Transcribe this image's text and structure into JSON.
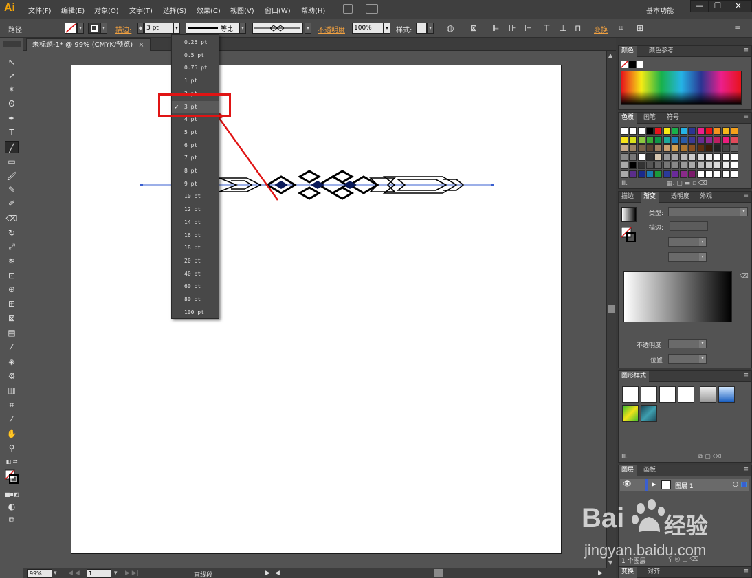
{
  "app": {
    "logo": "Ai",
    "menu": [
      "文件(F)",
      "编辑(E)",
      "对象(O)",
      "文字(T)",
      "选择(S)",
      "效果(C)",
      "视图(V)",
      "窗口(W)",
      "帮助(H)"
    ],
    "workspace": "基本功能",
    "window_buttons": {
      "minimize": "—",
      "restore": "❐",
      "close": "✕"
    }
  },
  "control_bar": {
    "object_type": "路径",
    "stroke_label": "描边:",
    "stroke_value": "3 pt",
    "profile_label": "等比",
    "opacity_label": "不透明度",
    "opacity_value": "100%",
    "style_label": "样式:",
    "transform_label": "变换"
  },
  "document": {
    "tab_title": "未标题-1* @ 99% (CMYK/预览)",
    "tab_close": "×"
  },
  "stroke_dropdown": {
    "items": [
      "0.25 pt",
      "0.5 pt",
      "0.75 pt",
      "1 pt",
      "2 pt",
      "3 pt",
      "4 pt",
      "5 pt",
      "6 pt",
      "7 pt",
      "8 pt",
      "9 pt",
      "10 pt",
      "12 pt",
      "14 pt",
      "16 pt",
      "18 pt",
      "20 pt",
      "40 pt",
      "60 pt",
      "80 pt",
      "100 pt"
    ],
    "selected_index": 5,
    "check_mark": "✔"
  },
  "status_bar": {
    "zoom": "99%",
    "artboard_number": "1",
    "tool_name": "直线段"
  },
  "panels": {
    "color": {
      "tabs": [
        "颜色",
        "颜色参考"
      ]
    },
    "swatches": {
      "tabs": [
        "色板",
        "画笔",
        "符号"
      ]
    },
    "gradient": {
      "tabs": [
        "描边",
        "渐变",
        "透明度",
        "外观"
      ],
      "type_label": "类型:",
      "stroke_label": "描边:",
      "opacity_label": "不透明度",
      "location_label": "位置"
    },
    "graphic_styles": {
      "tabs": [
        "图形样式"
      ]
    },
    "layers": {
      "tabs": [
        "图层",
        "画板"
      ],
      "layer_name": "图层 1",
      "footer_text": "1 个图层"
    },
    "bottom": {
      "tabs": [
        "变换",
        "对齐"
      ]
    }
  },
  "colors": {
    "accent_orange": "#f0a30a",
    "highlight_red": "#e01414",
    "selection_blue": "#3a5fd0"
  },
  "watermark": {
    "brand": "Bai",
    "brand_cn": "经验",
    "url": "jingyan.baidu.com"
  }
}
